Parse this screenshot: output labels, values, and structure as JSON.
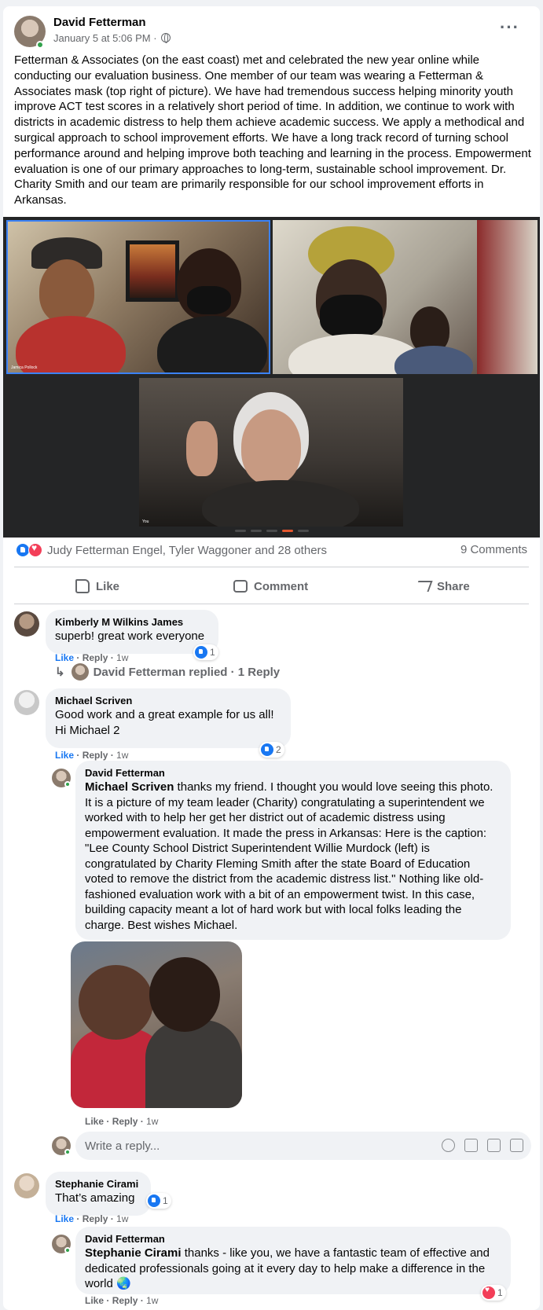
{
  "post": {
    "author": "David Fetterman",
    "timestamp": "January 5 at 5:06 PM",
    "separator": " · ",
    "text": "Fetterman & Associates (on the east coast) met and celebrated the new year online while conducting our evaluation business. One member of our team was wearing a Fetterman & Associates mask (top right of picture). We have had tremendous success helping minority youth improve ACT test scores in a relatively short period of time. In addition, we continue to work with districts in academic distress to help them achieve academic success. We apply a methodical and surgical approach to school improvement efforts. We have a long track record of turning school performance around and helping improve both teaching and learning in the process. Empowerment evaluation is one of our primary approaches to long-term, sustainable school improvement. Dr. Charity Smith and our team are primarily responsible for our school improvement efforts in Arkansas.",
    "video_tiles": [
      {
        "label": "Jamica Pollock"
      },
      {
        "label": ""
      },
      {
        "label": "You"
      }
    ]
  },
  "reactions": {
    "names": "Judy Fetterman Engel, Tyler Waggoner and 28 others",
    "comments_count": "9 Comments"
  },
  "actions": {
    "like": "Like",
    "comment": "Comment",
    "share": "Share"
  },
  "comments": [
    {
      "author": "Kimberly M Wilkins James",
      "text": "superb! great work everyone",
      "reaction_count": "1",
      "like": "Like",
      "reply": "Reply",
      "time": "1w",
      "replies_summary": "David Fetterman replied · 1 Reply"
    },
    {
      "author": "Michael Scriven",
      "text_line1": "Good work and a great example for us all!",
      "text_line2": "Hi Michael 2",
      "reaction_count": "2",
      "like": "Like",
      "reply": "Reply",
      "time": "1w",
      "reply_item": {
        "author": "David Fetterman",
        "tag": "Michael Scriven",
        "text": " thanks my friend. I thought you would love seeing this photo. It is a picture of my team leader (Charity) congratulating a superintendent we worked with to help her get her district out of academic distress using empowerment evaluation. It made the press in Arkansas: Here is the caption: \"Lee County School District Superintendent Willie Murdock (left) is congratulated by Charity Fleming Smith after the state Board of Education voted to remove the district from the academic distress list.\" Nothing like old-fashioned evaluation work with a bit of an empowerment twist. In this case, building capacity meant a lot of hard work but with local folks leading the charge. Best wishes Michael.",
        "like": "Like",
        "reply": "Reply",
        "time": "1w"
      },
      "write_reply_placeholder": "Write a reply..."
    },
    {
      "author": "Stephanie Cirami",
      "text": "That’s amazing",
      "reaction_count": "1",
      "like": "Like",
      "reply": "Reply",
      "time": "1w",
      "reply_item": {
        "author": "David Fetterman",
        "tag": "Stephanie Cirami",
        "text": " thanks - like you, we have a fantastic team of effective and dedicated professionals going at it every day to help make a difference in the world 🌏",
        "reaction_count": "1",
        "like": "Like",
        "reply": "Reply",
        "time": "1w"
      }
    }
  ],
  "icons": [
    "globe-icon",
    "more-icon",
    "like-icon",
    "comment-icon",
    "share-icon",
    "reply-arrow-icon",
    "emoji-icon",
    "camera-icon",
    "gif-icon",
    "sticker-icon"
  ],
  "colors": {
    "accent": "#1877f2",
    "love": "#f33e58",
    "online": "#31a24c",
    "bubble": "#f0f2f5"
  }
}
